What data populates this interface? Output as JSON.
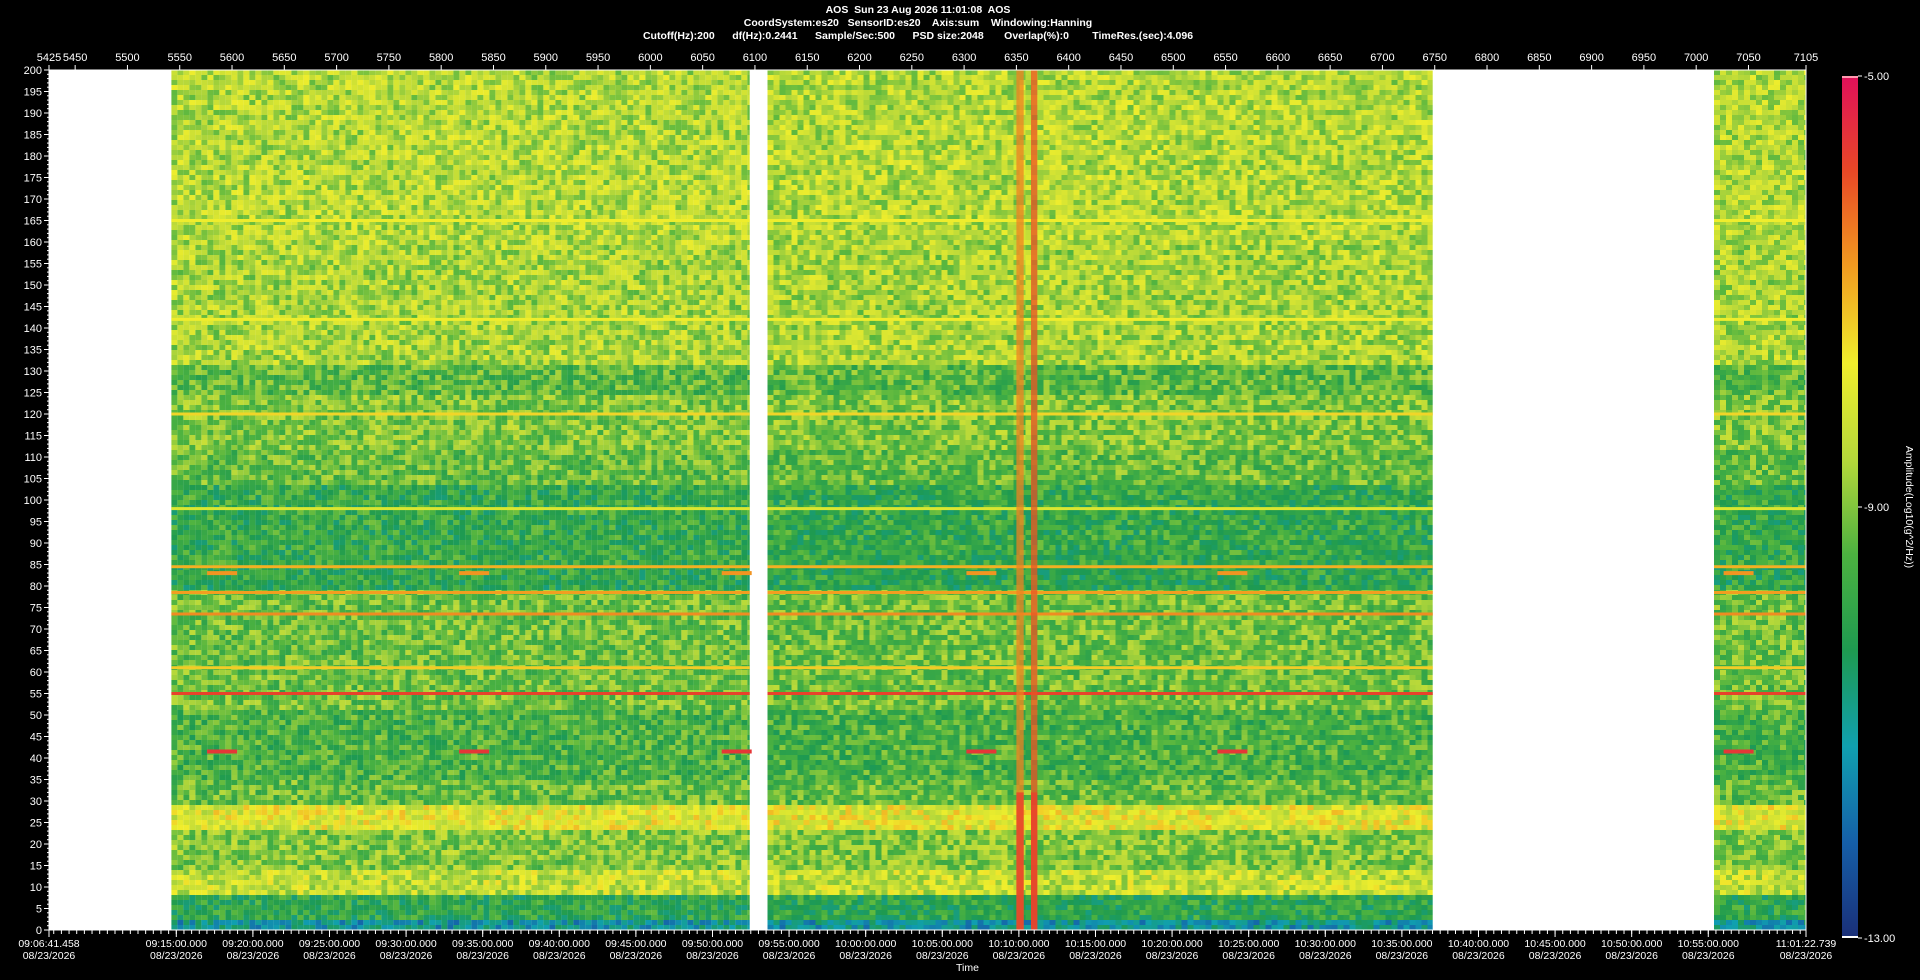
{
  "header": {
    "line1": "AOS  Sun 23 Aug 2026 11:01:08  AOS",
    "line2": "CoordSystem:es20   SensorID:es20    Axis:sum    Windowing:Hanning",
    "line3": "Cutoff(Hz):200      df(Hz):0.2441      Sample/Sec:500      PSD size:2048       Overlap(%):0        TimeRes.(sec):4.096"
  },
  "chart_data": {
    "type": "heatmap",
    "title": "AOS  Sun 23 Aug 2026 11:01:08  AOS",
    "xlabel": "Time",
    "ylabel": "",
    "colorbar_label": "Amplitude(Log10(g^2/Hz))",
    "colorbar_range": [
      -13.0,
      -5.0
    ],
    "colorbar_ticks": [
      "-5.00",
      "-9.00",
      "-13.00"
    ],
    "colormap": [
      "#1a2f78",
      "#155fa8",
      "#10a0b0",
      "#1e9a50",
      "#4cb240",
      "#b6d83a",
      "#f0ee2c",
      "#f29c20",
      "#e84826",
      "#e0105a"
    ],
    "ylim": [
      0,
      200
    ],
    "y_ticks": [
      0,
      5,
      10,
      15,
      20,
      25,
      30,
      35,
      40,
      45,
      50,
      55,
      60,
      65,
      70,
      75,
      80,
      85,
      90,
      95,
      100,
      105,
      110,
      115,
      120,
      125,
      130,
      135,
      140,
      145,
      150,
      155,
      160,
      165,
      170,
      175,
      180,
      185,
      190,
      195,
      200
    ],
    "top_axis_range": [
      5425,
      7105
    ],
    "top_axis_ticks": [
      5425,
      5450,
      5500,
      5550,
      5600,
      5650,
      5700,
      5750,
      5800,
      5850,
      5900,
      5950,
      6000,
      6050,
      6100,
      6150,
      6200,
      6250,
      6300,
      6350,
      6400,
      6450,
      6500,
      6550,
      6600,
      6650,
      6700,
      6750,
      6800,
      6850,
      6900,
      6950,
      7000,
      7050,
      7105
    ],
    "time_range": [
      "09:06:41.458",
      "11:01:22.739"
    ],
    "time_ticks": [
      {
        "time": "09:06:41.458",
        "date": "08/23/2026"
      },
      {
        "time": "09:15:00.000",
        "date": "08/23/2026"
      },
      {
        "time": "09:20:00.000",
        "date": "08/23/2026"
      },
      {
        "time": "09:25:00.000",
        "date": "08/23/2026"
      },
      {
        "time": "09:30:00.000",
        "date": "08/23/2026"
      },
      {
        "time": "09:35:00.000",
        "date": "08/23/2026"
      },
      {
        "time": "09:40:00.000",
        "date": "08/23/2026"
      },
      {
        "time": "09:45:00.000",
        "date": "08/23/2026"
      },
      {
        "time": "09:50:00.000",
        "date": "08/23/2026"
      },
      {
        "time": "09:55:00.000",
        "date": "08/23/2026"
      },
      {
        "time": "10:00:00.000",
        "date": "08/23/2026"
      },
      {
        "time": "10:05:00.000",
        "date": "08/23/2026"
      },
      {
        "time": "10:10:00.000",
        "date": "08/23/2026"
      },
      {
        "time": "10:15:00.000",
        "date": "08/23/2026"
      },
      {
        "time": "10:20:00.000",
        "date": "08/23/2026"
      },
      {
        "time": "10:25:00.000",
        "date": "08/23/2026"
      },
      {
        "time": "10:30:00.000",
        "date": "08/23/2026"
      },
      {
        "time": "10:35:00.000",
        "date": "08/23/2026"
      },
      {
        "time": "10:40:00.000",
        "date": "08/23/2026"
      },
      {
        "time": "10:45:00.000",
        "date": "08/23/2026"
      },
      {
        "time": "10:50:00.000",
        "date": "08/23/2026"
      },
      {
        "time": "10:55:00.000",
        "date": "08/23/2026"
      },
      {
        "time": "11:01:22.739",
        "date": "08/23/2026"
      }
    ],
    "data_segments": [
      {
        "x_start": 5542,
        "x_end": 6095
      },
      {
        "x_start": 6112,
        "x_end": 6748
      },
      {
        "x_start": 7017,
        "x_end": 7105
      }
    ],
    "gap_segments": [
      {
        "x_start": 5425,
        "x_end": 5542
      },
      {
        "x_start": 6095,
        "x_end": 6112
      },
      {
        "x_start": 6748,
        "x_end": 7017
      }
    ],
    "spectral_lines_hz": [
      {
        "freq": 55,
        "level": -5.8
      },
      {
        "freq": 73.5,
        "level": -6.6
      },
      {
        "freq": 78.5,
        "level": -6.8
      },
      {
        "freq": 84.5,
        "level": -7.0
      },
      {
        "freq": 61,
        "level": -7.3
      },
      {
        "freq": 120,
        "level": -7.4
      },
      {
        "freq": 142,
        "level": -7.7
      },
      {
        "freq": 165,
        "level": -7.7
      },
      {
        "freq": 98,
        "level": -8.0
      }
    ],
    "periodic_events": [
      {
        "x": 5580,
        "freq": 41.5,
        "level": -5.6
      },
      {
        "x": 5580,
        "freq": 83,
        "level": -6.7
      },
      {
        "x": 5821,
        "freq": 41.5,
        "level": -5.6
      },
      {
        "x": 5821,
        "freq": 83,
        "level": -6.7
      },
      {
        "x": 6072,
        "freq": 41.5,
        "level": -5.6
      },
      {
        "x": 6072,
        "freq": 83,
        "level": -6.7
      },
      {
        "x": 6306,
        "freq": 41.5,
        "level": -5.6
      },
      {
        "x": 6306,
        "freq": 83,
        "level": -6.7
      },
      {
        "x": 6546,
        "freq": 41.5,
        "level": -5.6
      },
      {
        "x": 6546,
        "freq": 83,
        "level": -6.7
      },
      {
        "x": 7030,
        "freq": 41.5,
        "level": -5.6
      },
      {
        "x": 7030,
        "freq": 83,
        "level": -6.7
      }
    ],
    "broadband_events": [
      {
        "x_start": 6350,
        "x_end": 6357,
        "level": -6.5
      },
      {
        "x_start": 6364,
        "x_end": 6370,
        "level": -6.0
      }
    ]
  }
}
